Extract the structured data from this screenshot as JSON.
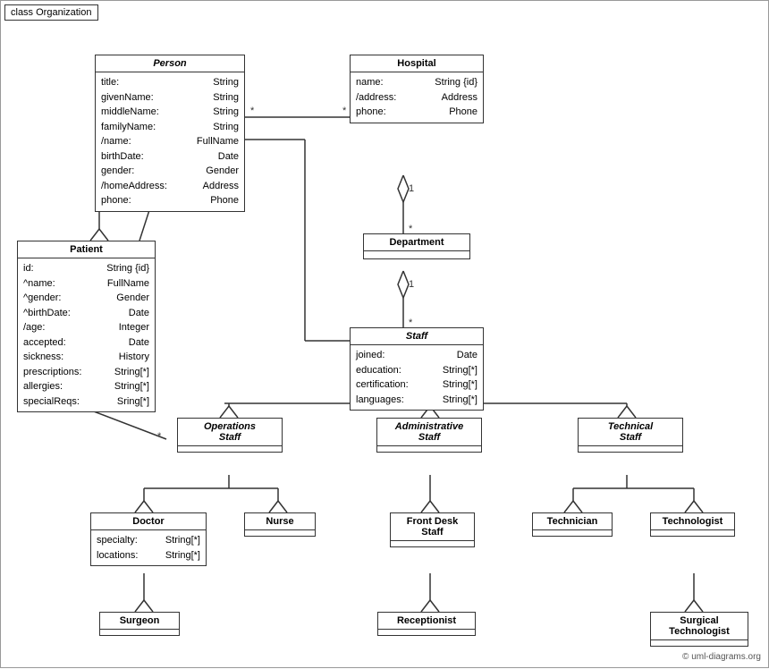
{
  "diagram": {
    "title": "class Organization",
    "copyright": "© uml-diagrams.org",
    "classes": {
      "person": {
        "name": "Person",
        "italic": true,
        "attrs": [
          [
            "title:",
            "String"
          ],
          [
            "givenName:",
            "String"
          ],
          [
            "middleName:",
            "String"
          ],
          [
            "familyName:",
            "String"
          ],
          [
            "/name:",
            "FullName"
          ],
          [
            "birthDate:",
            "Date"
          ],
          [
            "gender:",
            "Gender"
          ],
          [
            "/homeAddress:",
            "Address"
          ],
          [
            "phone:",
            "Phone"
          ]
        ]
      },
      "hospital": {
        "name": "Hospital",
        "italic": false,
        "attrs": [
          [
            "name:",
            "String {id}"
          ],
          [
            "/address:",
            "Address"
          ],
          [
            "phone:",
            "Phone"
          ]
        ]
      },
      "department": {
        "name": "Department",
        "italic": false,
        "attrs": []
      },
      "staff": {
        "name": "Staff",
        "italic": true,
        "attrs": [
          [
            "joined:",
            "Date"
          ],
          [
            "education:",
            "String[*]"
          ],
          [
            "certification:",
            "String[*]"
          ],
          [
            "languages:",
            "String[*]"
          ]
        ]
      },
      "patient": {
        "name": "Patient",
        "italic": false,
        "attrs": [
          [
            "id:",
            "String {id}"
          ],
          [
            "^name:",
            "FullName"
          ],
          [
            "^gender:",
            "Gender"
          ],
          [
            "^birthDate:",
            "Date"
          ],
          [
            "/age:",
            "Integer"
          ],
          [
            "accepted:",
            "Date"
          ],
          [
            "sickness:",
            "History"
          ],
          [
            "prescriptions:",
            "String[*]"
          ],
          [
            "allergies:",
            "String[*]"
          ],
          [
            "specialReqs:",
            "Sring[*]"
          ]
        ]
      },
      "operationsStaff": {
        "name": "Operations\nStaff",
        "italic": true,
        "attrs": []
      },
      "administrativeStaff": {
        "name": "Administrative\nStaff",
        "italic": true,
        "attrs": []
      },
      "technicalStaff": {
        "name": "Technical\nStaff",
        "italic": true,
        "attrs": []
      },
      "doctor": {
        "name": "Doctor",
        "italic": false,
        "attrs": [
          [
            "specialty:",
            "String[*]"
          ],
          [
            "locations:",
            "String[*]"
          ]
        ]
      },
      "nurse": {
        "name": "Nurse",
        "italic": false,
        "attrs": []
      },
      "frontDeskStaff": {
        "name": "Front Desk\nStaff",
        "italic": false,
        "attrs": []
      },
      "technician": {
        "name": "Technician",
        "italic": false,
        "attrs": []
      },
      "technologist": {
        "name": "Technologist",
        "italic": false,
        "attrs": []
      },
      "surgeon": {
        "name": "Surgeon",
        "italic": false,
        "attrs": []
      },
      "receptionist": {
        "name": "Receptionist",
        "italic": false,
        "attrs": []
      },
      "surgicalTechnologist": {
        "name": "Surgical\nTechnologist",
        "italic": false,
        "attrs": []
      }
    }
  }
}
